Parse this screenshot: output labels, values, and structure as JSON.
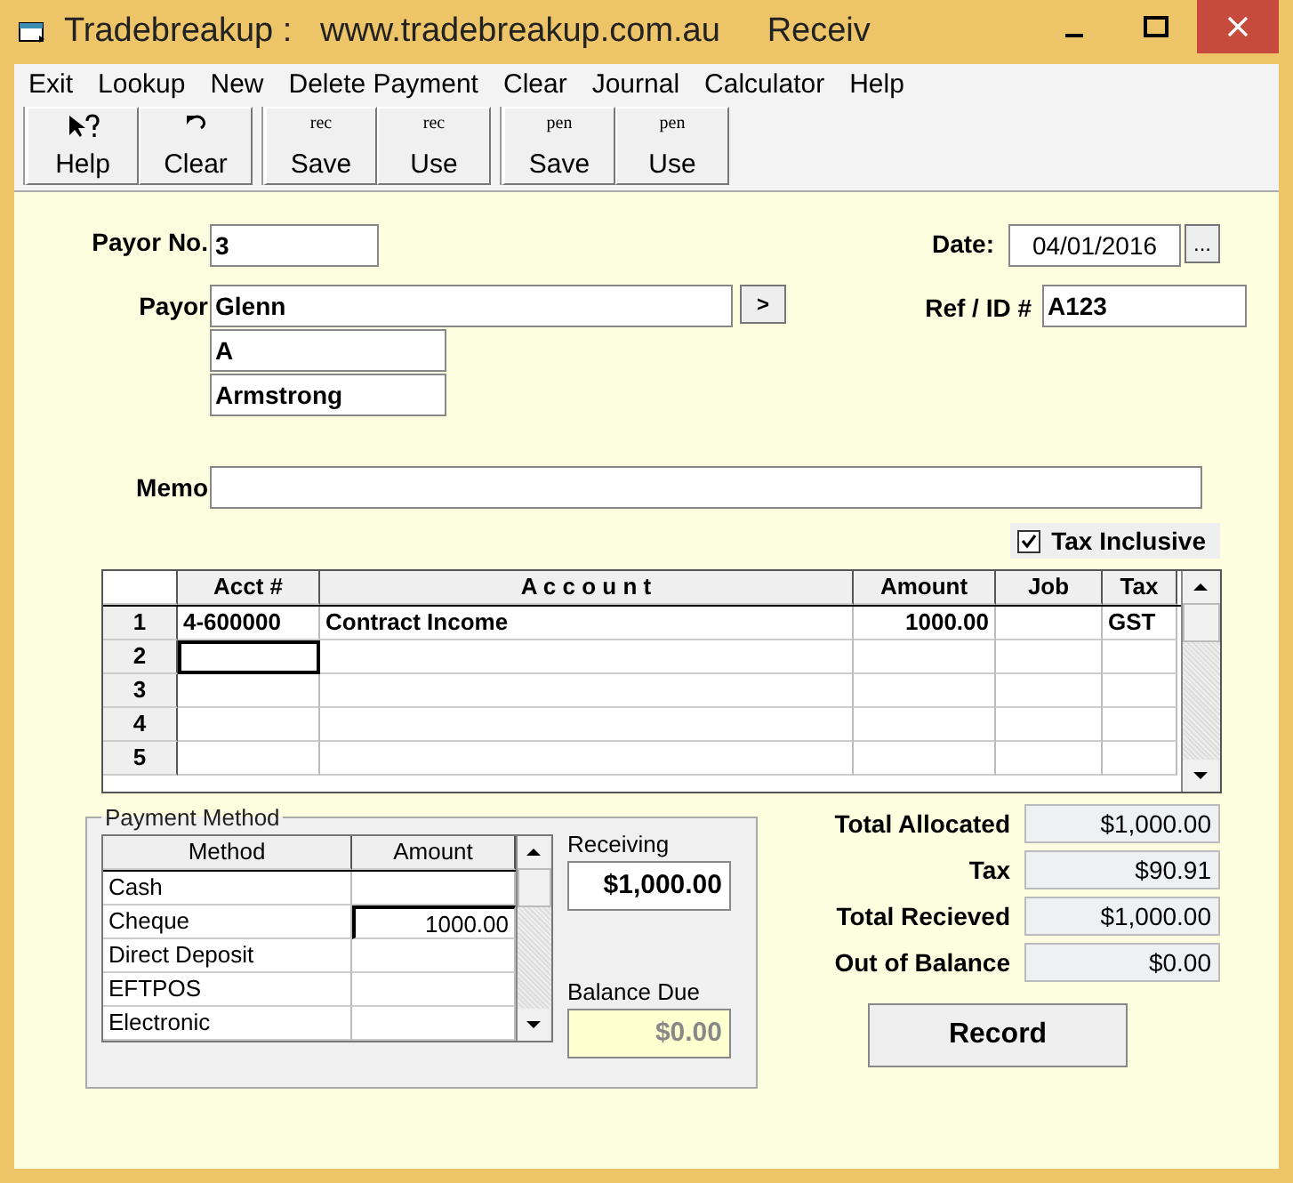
{
  "window": {
    "title": "Tradebreakup :   www.tradebreakup.com.au     Receiv"
  },
  "menu": [
    "Exit",
    "Lookup",
    "New",
    "Delete Payment",
    "Clear",
    "Journal",
    "Calculator",
    "Help"
  ],
  "toolbar": [
    {
      "kind": "help",
      "label": "Help",
      "group_start": true
    },
    {
      "kind": "undo",
      "label": "Clear",
      "group_start": false
    },
    {
      "kind": "text",
      "icon_text": "rec",
      "label": "Save",
      "group_start": true
    },
    {
      "kind": "text",
      "icon_text": "rec",
      "label": "Use",
      "group_start": false
    },
    {
      "kind": "text",
      "icon_text": "pen",
      "label": "Save",
      "group_start": true
    },
    {
      "kind": "text",
      "icon_text": "pen",
      "label": "Use",
      "group_start": false
    }
  ],
  "form": {
    "payor_no_label": "Payor No.",
    "payor_no": "3",
    "payor_label": "Payor",
    "payor_lines": [
      "Glenn",
      "A",
      "Armstrong"
    ],
    "payor_button": ">",
    "date_label": "Date:",
    "date": "04/01/2016",
    "date_button": "...",
    "ref_label": "Ref / ID #",
    "ref": "A123",
    "memo_label": "Memo",
    "tax_inclusive": {
      "label": "Tax Inclusive",
      "checked": true
    }
  },
  "grid": {
    "columns": [
      "Acct #",
      "A c c o u n t",
      "Amount",
      "Job",
      "Tax"
    ],
    "rows": [
      {
        "num": "1",
        "cells": [
          "4-600000",
          "Contract Income",
          "1000.00",
          "",
          "GST"
        ],
        "focused": false
      },
      {
        "num": "2",
        "cells": [
          "",
          "",
          "",
          "",
          ""
        ],
        "focused": true
      },
      {
        "num": "3",
        "cells": [
          "",
          "",
          "",
          "",
          ""
        ],
        "focused": false
      },
      {
        "num": "4",
        "cells": [
          "",
          "",
          "",
          "",
          ""
        ],
        "focused": false
      },
      {
        "num": "5",
        "cells": [
          "",
          "",
          "",
          "",
          ""
        ],
        "focused": false
      }
    ]
  },
  "payment": {
    "title": "Payment Method",
    "columns": [
      "Method",
      "Amount"
    ],
    "rows": [
      {
        "method": "Cash",
        "amount": "",
        "focused": false
      },
      {
        "method": "Cheque",
        "amount": "1000.00",
        "focused": true
      },
      {
        "method": "Direct Deposit",
        "amount": "",
        "focused": false
      },
      {
        "method": "EFTPOS",
        "amount": "",
        "focused": false
      },
      {
        "method": "Electronic",
        "amount": "",
        "focused": false
      }
    ],
    "receiving_label": "Receiving",
    "receiving": "$1,000.00",
    "balance_label": "Balance Due",
    "balance": "$0.00"
  },
  "totals": [
    {
      "label": "Total Allocated",
      "value": "$1,000.00"
    },
    {
      "label": "Tax",
      "value": "$90.91"
    },
    {
      "label": "Total Recieved",
      "value": "$1,000.00"
    },
    {
      "label": "Out of Balance",
      "value": "$0.00"
    }
  ],
  "record_button": "Record"
}
